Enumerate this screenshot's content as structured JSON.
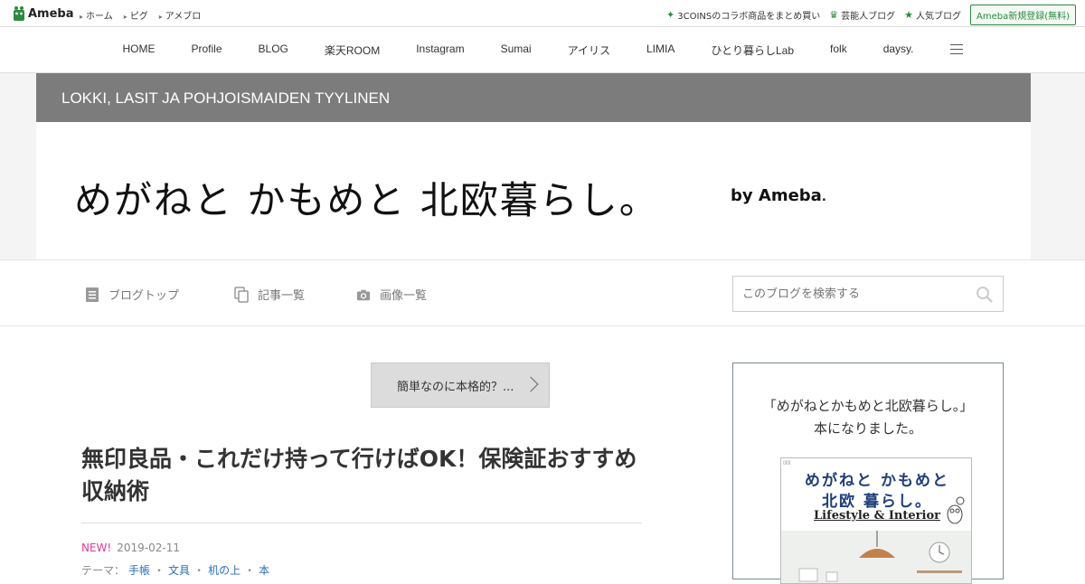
{
  "topbar": {
    "logo_text": "Ameba",
    "links": [
      "ホーム",
      "ピグ",
      "アメブロ"
    ],
    "right_links": [
      {
        "icon": "sparkle-icon",
        "label": "3COINSのコラボ商品をまとめ買い"
      },
      {
        "icon": "crown-icon",
        "label": "芸能人ブログ"
      },
      {
        "icon": "star-icon",
        "label": "人気ブログ"
      }
    ],
    "register_label": "Ameba新規登録(無料)"
  },
  "mainnav": {
    "items": [
      "HOME",
      "Profile",
      "BLOG",
      "楽天ROOM",
      "Instagram",
      "Sumai",
      "アイリス",
      "LIMIA",
      "ひとり暮らしLab",
      "folk",
      "daysy."
    ]
  },
  "header": {
    "subtitle": "LOKKI, LASIT JA POHJOISMAIDEN TYYLINEN",
    "title": "めがねと かもめと 北欧暮らし。",
    "by": "by Ameba",
    "by_mark": "."
  },
  "subnav": {
    "items": [
      {
        "icon": "document-icon",
        "label": "ブログトップ"
      },
      {
        "icon": "copy-icon",
        "label": "記事一覧"
      },
      {
        "icon": "camera-icon",
        "label": "画像一覧"
      }
    ],
    "search_placeholder": "このブログを検索する"
  },
  "content": {
    "promo_label": "簡単なのに本格的？...",
    "article_title": "無印良品・これだけ持って行けばOK！保険証おすすめ収納術",
    "new_badge": "NEW!",
    "date": "2019-02-11",
    "theme_label": "テーマ：",
    "theme_links": [
      "手帳",
      "文具",
      "机の上",
      "本"
    ]
  },
  "sidebar": {
    "line1": "「めがねとかもめと北欧暮らし。」",
    "line2": "本になりました。",
    "book": {
      "line1": "めがねと かもめと",
      "line2": "北欧 暮らし。",
      "line3": "Lifestyle & Interior"
    }
  },
  "colors": {
    "header_strip": "#7c7c7c",
    "ameba_green": "#2d8a3e",
    "new_pink": "#e0399a",
    "link_blue": "#2a6fb8"
  }
}
